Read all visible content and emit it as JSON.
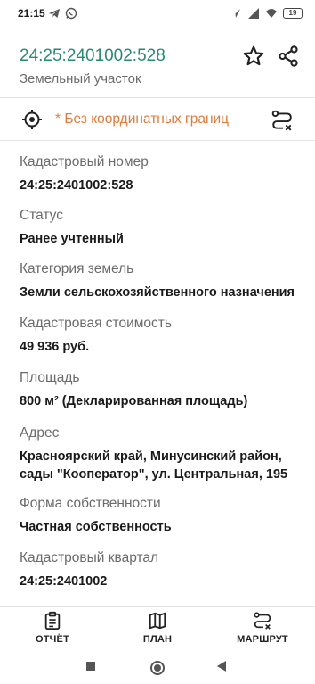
{
  "statusbar": {
    "time": "21:15",
    "battery": "19"
  },
  "header": {
    "title": "24:25:2401002:528",
    "subtitle": "Земельный участок",
    "icons": {
      "favorite": "star-icon",
      "share": "share-icon"
    }
  },
  "coord_warning": {
    "text": "* Без координатных границ",
    "icons": {
      "target": "crosshair-icon",
      "route": "route-clear-icon"
    }
  },
  "fields": [
    {
      "label": "Кадастровый номер",
      "value": "24:25:2401002:528"
    },
    {
      "label": "Статус",
      "value": "Ранее учтенный"
    },
    {
      "label": "Категория земель",
      "value": "Земли сельскохозяйственного назначения"
    },
    {
      "label": "Кадастровая стоимость",
      "value": "49 936 руб."
    },
    {
      "label": "Площадь",
      "value": "800 м² (Декларированная площадь)"
    },
    {
      "label": "Адрес",
      "value_lines": [
        "Красноярский край, Минусинский район,",
        "сады \"Кооператор\", ул. Центральная, 195"
      ]
    },
    {
      "label": "Форма собственности",
      "value": "Частная собственность"
    },
    {
      "label": "Кадастровый квартал",
      "value": "24:25:2401002"
    }
  ],
  "bottom_nav": {
    "report": "ОТЧЁТ",
    "plan": "ПЛАН",
    "route": "МАРШРУТ"
  },
  "colors": {
    "accent_title": "#2b8a6e",
    "warning": "#e07b3c",
    "label": "#6b6b6b"
  }
}
